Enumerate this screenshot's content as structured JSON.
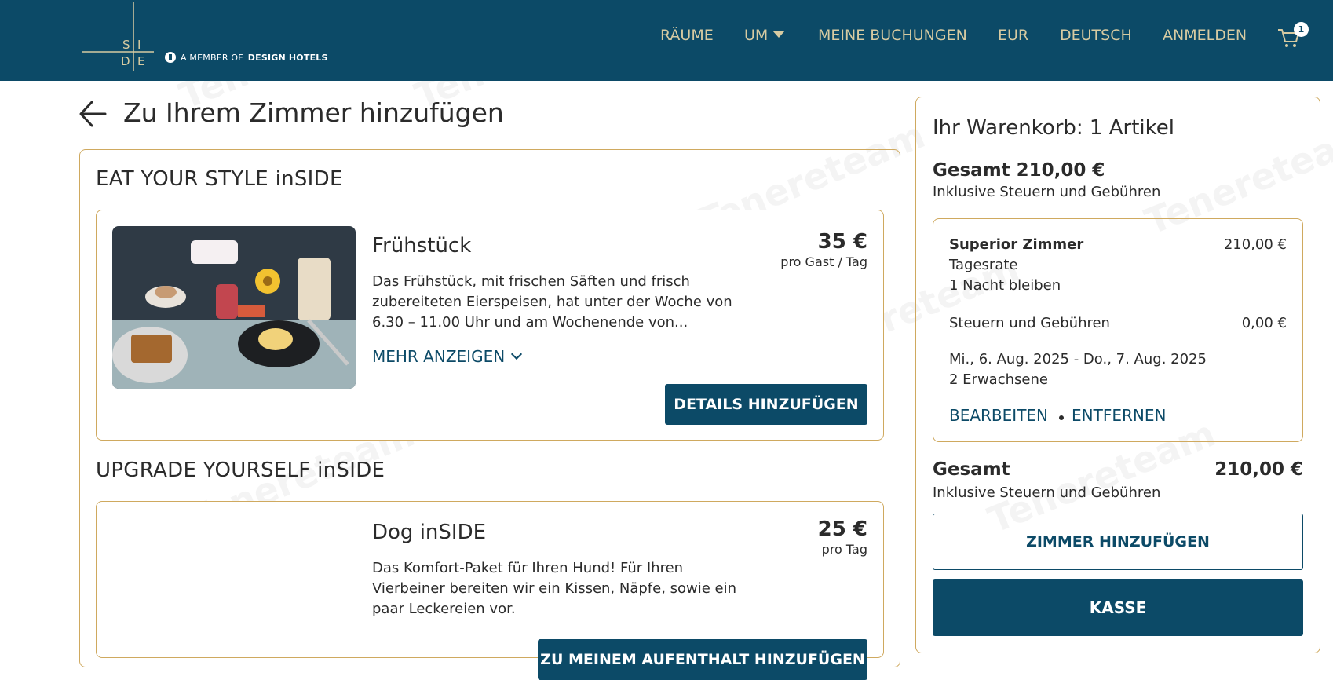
{
  "header": {
    "logo_letters": [
      "S",
      "I",
      "D",
      "E"
    ],
    "member_prefix": "A MEMBER OF",
    "member_brand": "DESIGN HOTELS",
    "nav": [
      {
        "label": "RÄUME"
      },
      {
        "label": "UM"
      },
      {
        "label": "MEINE BUCHUNGEN"
      },
      {
        "label": "EUR"
      },
      {
        "label": "DEUTSCH"
      },
      {
        "label": "ANMELDEN"
      }
    ],
    "cart_count": "1",
    "cart_icon": "shopping-cart-icon"
  },
  "page": {
    "title": "Zu Ihrem Zimmer hinzufügen",
    "back_icon": "arrow-left-icon"
  },
  "sections": [
    {
      "heading": "EAT YOUR STYLE inSIDE",
      "card": {
        "title": "Frühstück",
        "price": "35 €",
        "unit": "pro Gast / Tag",
        "description": "Das Frühstück, mit frischen Säften und frisch zubereiteten Eierspeisen, hat unter der Woche von 6.30 – 11.00 Uhr und am Wochenende von...",
        "more_label": "MEHR ANZEIGEN",
        "button_label": "DETAILS HINZUFÜGEN"
      }
    },
    {
      "heading": "UPGRADE YOURSELF inSIDE",
      "card": {
        "title": "Dog inSIDE",
        "price": "25 €",
        "unit": "pro Tag",
        "description": "Das Komfort-Paket für Ihren Hund! Für Ihren Vierbeiner bereiten wir ein Kissen, Näpfe, sowie ein paar Leckereien vor.",
        "button_label": "ZU MEINEM AUFENTHALT HINZUFÜGEN"
      }
    }
  ],
  "cart": {
    "title": "Ihr Warenkorb: 1 Artikel",
    "total_label": "Gesamt 210,00 €",
    "incl_label": "Inklusive Steuern und Gebühren",
    "item": {
      "name": "Superior Zimmer",
      "price": "210,00 €",
      "rate": "Tagesrate",
      "stay_link": "1 Nacht bleiben",
      "tax_label": "Steuern und Gebühren",
      "tax_value": "0,00 €",
      "dates": "Mi., 6. Aug. 2025 - Do., 7. Aug. 2025",
      "guests": "2 Erwachsene",
      "edit_label": "BEARBEITEN",
      "remove_label": "ENTFERNEN"
    },
    "sum_label": "Gesamt",
    "sum_value": "210,00 €",
    "sum_incl": "Inklusive Steuern und Gebühren",
    "add_room_label": "ZIMMER HINZUFÜGEN",
    "checkout_label": "KASSE"
  },
  "watermark": "Tenereteam",
  "colors": {
    "header_bg": "#0c4a67",
    "nav_text": "#d7cba2",
    "border_gold": "#cfa95f",
    "accent": "#0c4a67"
  }
}
